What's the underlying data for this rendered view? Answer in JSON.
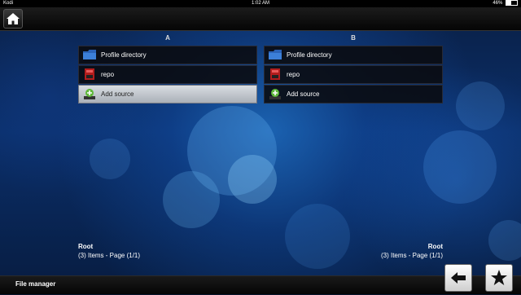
{
  "status_bar": {
    "app_name": "Kodi",
    "time": "1:02 AM",
    "battery": "46%"
  },
  "panels": [
    {
      "header": "A",
      "items": [
        {
          "label": "Profile directory",
          "icon": "folder-icon"
        },
        {
          "label": "repo",
          "icon": "repo-icon"
        },
        {
          "label": "Add source",
          "icon": "add-source-icon",
          "selected": true
        }
      ],
      "footer": {
        "title": "Root",
        "info": "(3) Items - Page (1/1)"
      }
    },
    {
      "header": "B",
      "items": [
        {
          "label": "Profile directory",
          "icon": "folder-icon"
        },
        {
          "label": "repo",
          "icon": "repo-icon"
        },
        {
          "label": "Add source",
          "icon": "add-source-icon"
        }
      ],
      "footer": {
        "title": "Root",
        "info": "(3) Items - Page (1/1)"
      }
    }
  ],
  "bottom_bar": {
    "title": "File manager"
  },
  "colors": {
    "selected_row": "#c4c9cf",
    "row_bg": "#0a0a0e",
    "accent_blue": "#1e6fd0"
  }
}
